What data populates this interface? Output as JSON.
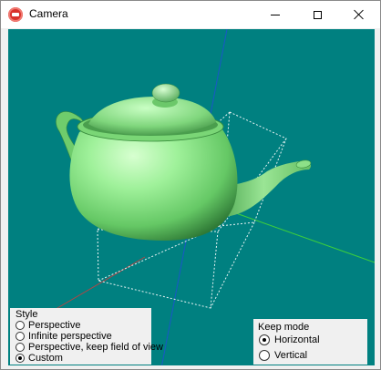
{
  "window": {
    "title": "Camera",
    "controls": {
      "minimize": "—",
      "maximize": "□",
      "close": "✕"
    }
  },
  "style_panel": {
    "legend": "Style",
    "options": [
      {
        "label": "Perspective",
        "checked": false
      },
      {
        "label": "Infinite perspective",
        "checked": false
      },
      {
        "label": "Perspective, keep field of view",
        "checked": false
      },
      {
        "label": "Custom",
        "checked": true
      }
    ]
  },
  "keep_mode_panel": {
    "legend": "Keep mode",
    "options": [
      {
        "label": "Horizontal",
        "checked": true
      },
      {
        "label": "Vertical",
        "checked": false
      }
    ]
  },
  "scene": {
    "background_color": "#008080",
    "teapot_color": "#7fdd7f",
    "axis_colors": {
      "blue": "#1a56c8",
      "green": "#3ccf3c",
      "red": "#b44444"
    }
  }
}
